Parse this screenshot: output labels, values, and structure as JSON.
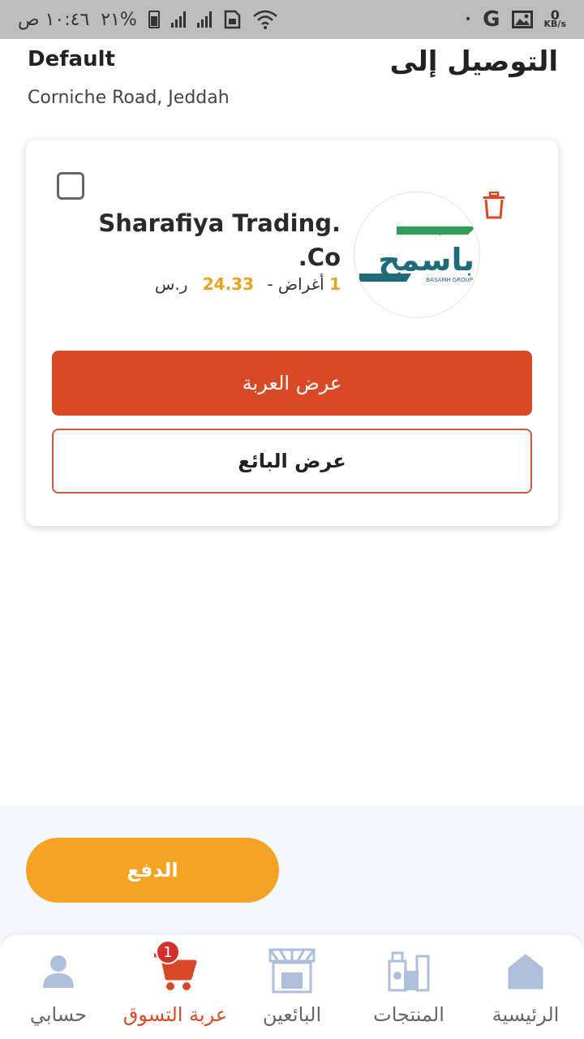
{
  "status_bar": {
    "time": "١٠:٤٦ ص",
    "battery": "٢١%",
    "kbs_value": "0",
    "kbs_unit": "KB/s",
    "google_glyph": "G",
    "dot": "•"
  },
  "header": {
    "address_label": "Default",
    "address_text": "Corniche Road, Jeddah",
    "title": "التوصيل إلى"
  },
  "cart_card": {
    "vendor_name": "Sharafiya Trading.\n.Co",
    "items_count": "1",
    "items_label": "أغراض -",
    "total": "24.33",
    "currency": "ر.س",
    "view_cart_label": "عرض العربة",
    "view_vendor_label": "عرض البائع",
    "logo": {
      "arabic_text": "باسمح",
      "top_text": "مجموعة",
      "brand_text": "BASAMH GROUP",
      "primary_color": "#1f6b7a",
      "accent_color": "#2e9e5b"
    }
  },
  "checkout": {
    "pay_label": "الدفع"
  },
  "bottom_nav": {
    "items": [
      {
        "label": "حسابي",
        "icon": "person-icon"
      },
      {
        "label": "عربة التسوق",
        "icon": "cart-icon",
        "badge": "1"
      },
      {
        "label": "البائعين",
        "icon": "store-icon"
      },
      {
        "label": "المنتجات",
        "icon": "products-icon"
      },
      {
        "label": "الرئيسية",
        "icon": "home-icon"
      }
    ]
  },
  "colors": {
    "primary": "#d84a26",
    "accent_orange": "#f4a322",
    "price": "#e9a21d",
    "nav_icon": "#aebfdc"
  }
}
